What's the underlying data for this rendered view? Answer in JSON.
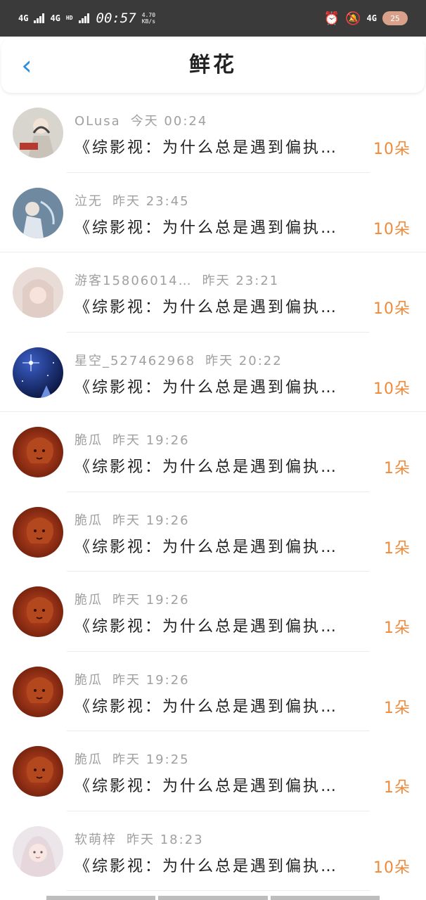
{
  "status_bar": {
    "sim1": "4G",
    "sim2": "4G",
    "sim2_sup": "HD",
    "time": "00:57",
    "speed_value": "4.70",
    "speed_unit": "KB/s",
    "net_right": "4G",
    "battery": "25"
  },
  "header": {
    "back_icon": "‹",
    "title": "鲜花"
  },
  "list": {
    "items": [
      {
        "user": "OLusa",
        "time": "今天 00:24",
        "book": "《综影视：为什么总是遇到偏执…",
        "count": "10朵",
        "avatar": "a1"
      },
      {
        "user": "泣无",
        "time": "昨天 23:45",
        "book": "《综影视：为什么总是遇到偏执…",
        "count": "10朵",
        "avatar": "a2"
      },
      {
        "user": "游客15806014…",
        "time": "昨天 23:21",
        "book": "《综影视：为什么总是遇到偏执…",
        "count": "10朵",
        "avatar": "a3"
      },
      {
        "user": "星空_527462968",
        "time": "昨天 20:22",
        "book": "《综影视：为什么总是遇到偏执…",
        "count": "10朵",
        "avatar": "a4"
      },
      {
        "user": "脆瓜",
        "time": "昨天 19:26",
        "book": "《综影视：为什么总是遇到偏执…",
        "count": "1朵",
        "avatar": "a5"
      },
      {
        "user": "脆瓜",
        "time": "昨天 19:26",
        "book": "《综影视：为什么总是遇到偏执…",
        "count": "1朵",
        "avatar": "a5"
      },
      {
        "user": "脆瓜",
        "time": "昨天 19:26",
        "book": "《综影视：为什么总是遇到偏执…",
        "count": "1朵",
        "avatar": "a5"
      },
      {
        "user": "脆瓜",
        "time": "昨天 19:26",
        "book": "《综影视：为什么总是遇到偏执…",
        "count": "1朵",
        "avatar": "a5"
      },
      {
        "user": "脆瓜",
        "time": "昨天 19:25",
        "book": "《综影视：为什么总是遇到偏执…",
        "count": "1朵",
        "avatar": "a5"
      },
      {
        "user": "软萌梓",
        "time": "昨天 18:23",
        "book": "《综影视：为什么总是遇到偏执…",
        "count": "10朵",
        "avatar": "a6"
      }
    ]
  },
  "colors": {
    "accent_blue": "#2a8ee0",
    "count_orange": "#ef8a3a",
    "meta_gray": "#a0a0a0"
  }
}
